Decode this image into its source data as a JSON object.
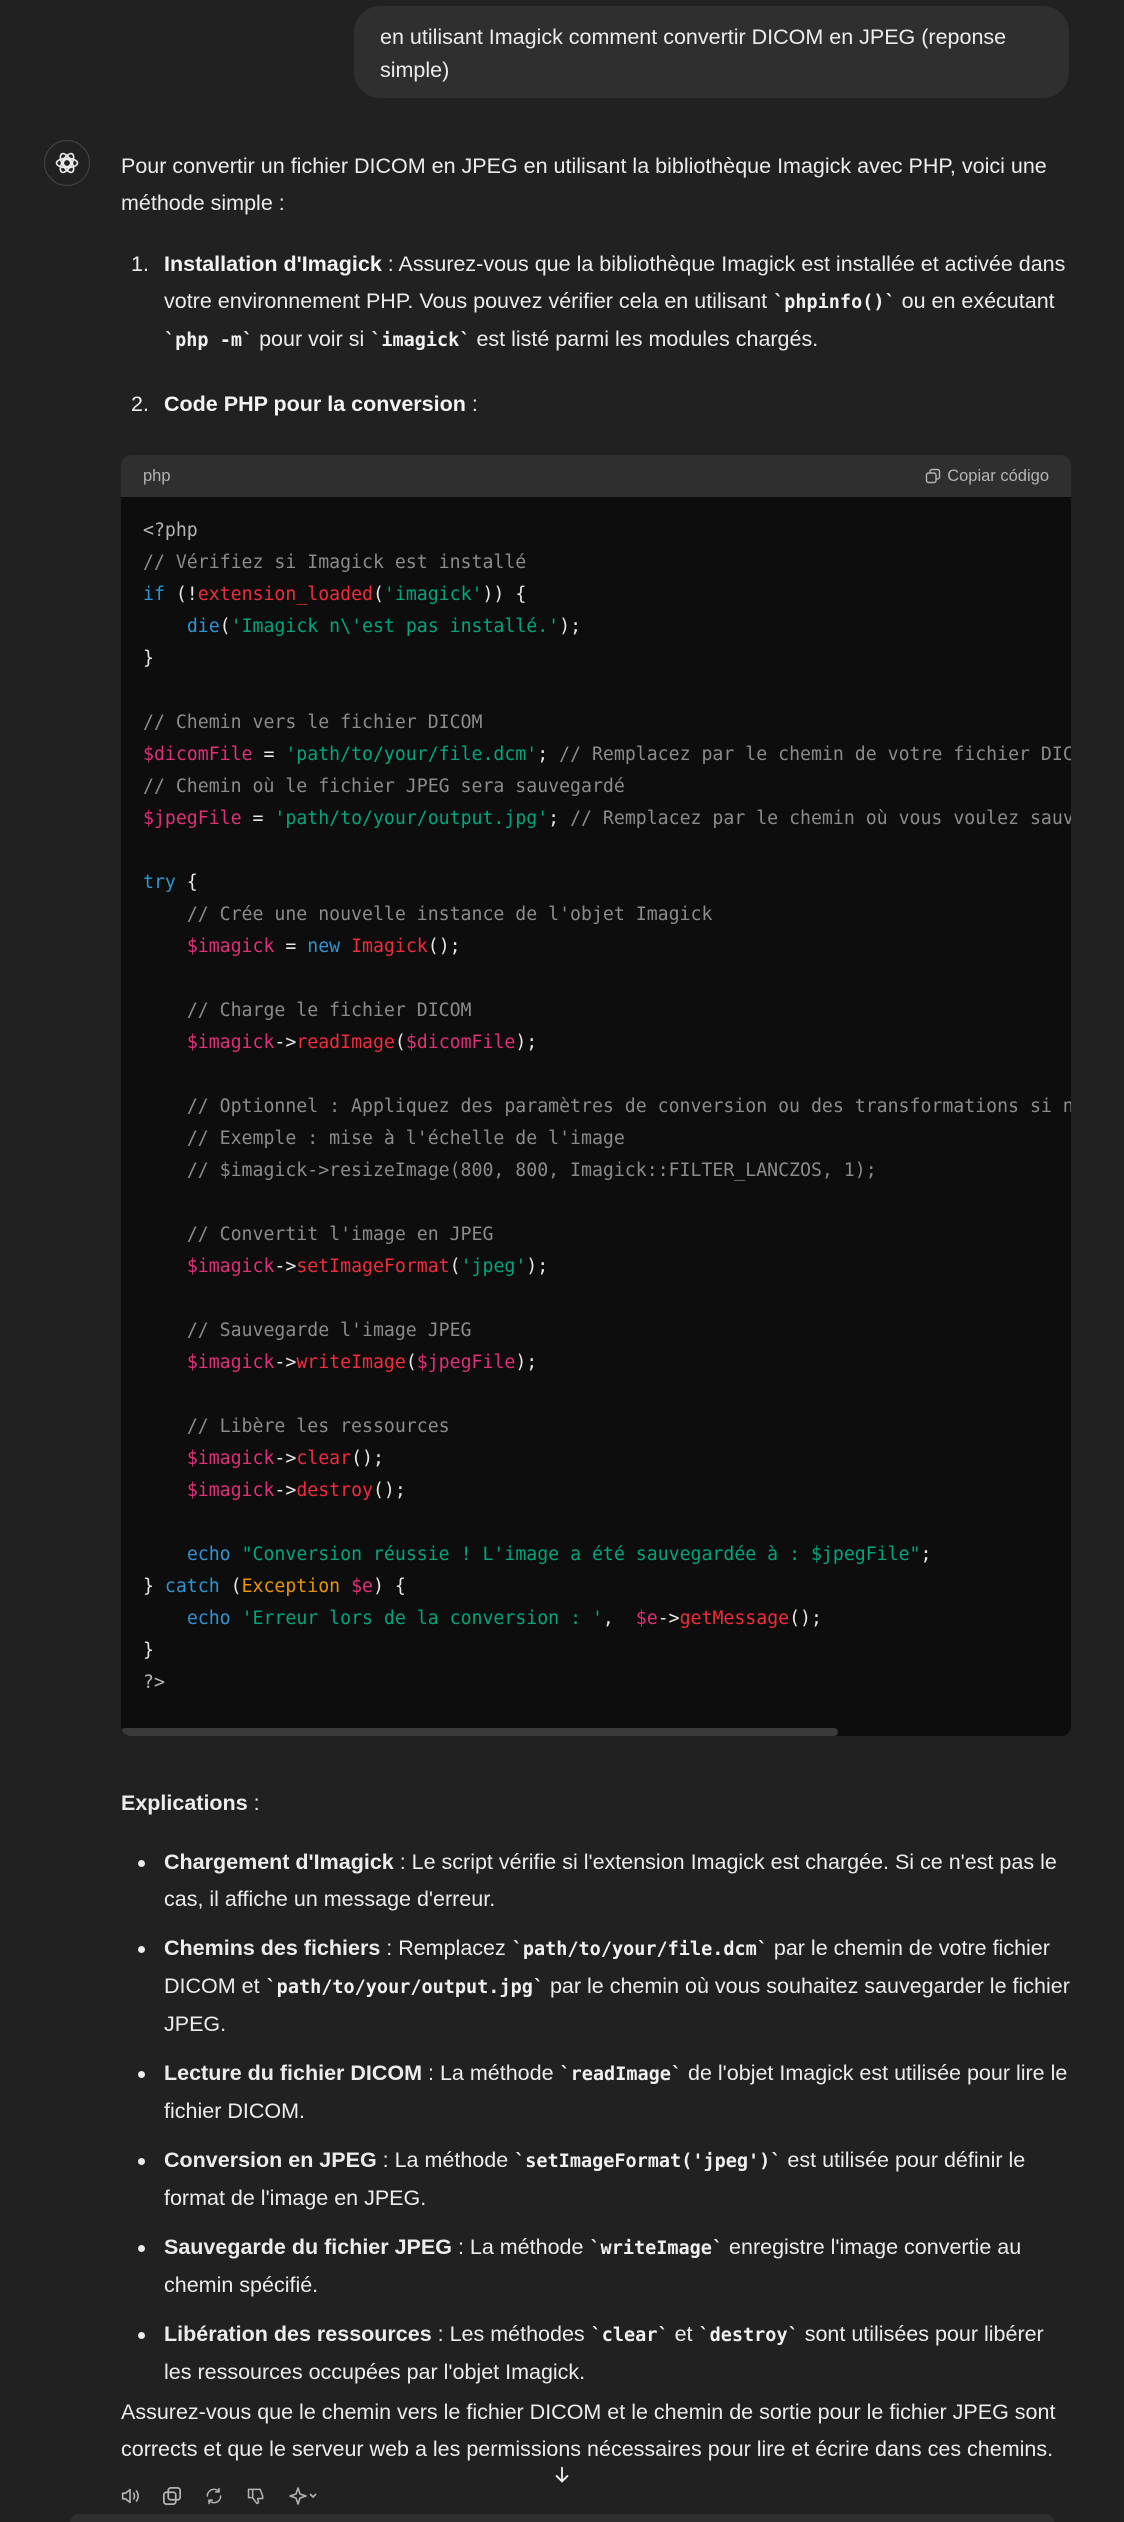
{
  "user_message": "en utilisant Imagick comment convertir DICOM en JPEG (reponse simple)",
  "answer": {
    "intro": "Pour convertir un fichier DICOM en JPEG en utilisant la bibliothèque Imagick avec PHP, voici une méthode simple :",
    "steps": [
      {
        "num": "1.",
        "title": "Installation d'Imagick",
        "t1": " : Assurez-vous que la bibliothèque Imagick est installée et activée dans votre environnement PHP. Vous pouvez vérifier cela en utilisant ",
        "c1": "`phpinfo()`",
        "t2": " ou en exécutant ",
        "c2": "`php -m`",
        "t3": " pour voir si ",
        "c3": "`imagick`",
        "t4": " est listé parmi les modules chargés."
      },
      {
        "num": "2.",
        "title": "Code PHP pour la conversion",
        "t1": " :"
      }
    ]
  },
  "code": {
    "language": "php",
    "copy_label": "Copiar código",
    "lines": [
      [
        {
          "t": "<?php",
          "c": "php"
        }
      ],
      [
        {
          "t": "// Vérifiez si Imagick est installé",
          "c": "com"
        }
      ],
      [
        {
          "t": "if",
          "c": "kw"
        },
        {
          "t": " (!",
          "c": "plain"
        },
        {
          "t": "extension_loaded",
          "c": "fn"
        },
        {
          "t": "(",
          "c": "plain"
        },
        {
          "t": "'imagick'",
          "c": "str"
        },
        {
          "t": ")) {",
          "c": "plain"
        }
      ],
      [
        {
          "t": "    ",
          "c": "plain"
        },
        {
          "t": "die",
          "c": "kw"
        },
        {
          "t": "(",
          "c": "plain"
        },
        {
          "t": "'Imagick n\\'est pas installé.'",
          "c": "str"
        },
        {
          "t": ");",
          "c": "plain"
        }
      ],
      [
        {
          "t": "}",
          "c": "plain"
        }
      ],
      [
        {
          "t": "",
          "c": "plain"
        }
      ],
      [
        {
          "t": "// Chemin vers le fichier DICOM",
          "c": "com"
        }
      ],
      [
        {
          "t": "$dicomFile",
          "c": "var"
        },
        {
          "t": " = ",
          "c": "plain"
        },
        {
          "t": "'path/to/your/file.dcm'",
          "c": "str"
        },
        {
          "t": "; ",
          "c": "plain"
        },
        {
          "t": "// Remplacez par le chemin de votre fichier DICOM",
          "c": "com"
        }
      ],
      [
        {
          "t": "// Chemin où le fichier JPEG sera sauvegardé",
          "c": "com"
        }
      ],
      [
        {
          "t": "$jpegFile",
          "c": "var"
        },
        {
          "t": " = ",
          "c": "plain"
        },
        {
          "t": "'path/to/your/output.jpg'",
          "c": "str"
        },
        {
          "t": "; ",
          "c": "plain"
        },
        {
          "t": "// Remplacez par le chemin où vous voulez sauvegarder",
          "c": "com"
        }
      ],
      [
        {
          "t": "",
          "c": "plain"
        }
      ],
      [
        {
          "t": "try",
          "c": "kw"
        },
        {
          "t": " {",
          "c": "plain"
        }
      ],
      [
        {
          "t": "    ",
          "c": "plain"
        },
        {
          "t": "// Crée une nouvelle instance de l'objet Imagick",
          "c": "com"
        }
      ],
      [
        {
          "t": "    ",
          "c": "plain"
        },
        {
          "t": "$imagick",
          "c": "var"
        },
        {
          "t": " = ",
          "c": "plain"
        },
        {
          "t": "new",
          "c": "kw"
        },
        {
          "t": " ",
          "c": "plain"
        },
        {
          "t": "Imagick",
          "c": "fn"
        },
        {
          "t": "();",
          "c": "plain"
        }
      ],
      [
        {
          "t": "",
          "c": "plain"
        }
      ],
      [
        {
          "t": "    ",
          "c": "plain"
        },
        {
          "t": "// Charge le fichier DICOM",
          "c": "com"
        }
      ],
      [
        {
          "t": "    ",
          "c": "plain"
        },
        {
          "t": "$imagick",
          "c": "var"
        },
        {
          "t": "->",
          "c": "plain"
        },
        {
          "t": "readImage",
          "c": "fn"
        },
        {
          "t": "(",
          "c": "plain"
        },
        {
          "t": "$dicomFile",
          "c": "var"
        },
        {
          "t": ");",
          "c": "plain"
        }
      ],
      [
        {
          "t": "",
          "c": "plain"
        }
      ],
      [
        {
          "t": "    ",
          "c": "plain"
        },
        {
          "t": "// Optionnel : Appliquez des paramètres de conversion ou des transformations si nécessaire",
          "c": "com"
        }
      ],
      [
        {
          "t": "    ",
          "c": "plain"
        },
        {
          "t": "// Exemple : mise à l'échelle de l'image",
          "c": "com"
        }
      ],
      [
        {
          "t": "    ",
          "c": "plain"
        },
        {
          "t": "// $imagick->resizeImage(800, 800, Imagick::FILTER_LANCZOS, 1);",
          "c": "com"
        }
      ],
      [
        {
          "t": "",
          "c": "plain"
        }
      ],
      [
        {
          "t": "    ",
          "c": "plain"
        },
        {
          "t": "// Convertit l'image en JPEG",
          "c": "com"
        }
      ],
      [
        {
          "t": "    ",
          "c": "plain"
        },
        {
          "t": "$imagick",
          "c": "var"
        },
        {
          "t": "->",
          "c": "plain"
        },
        {
          "t": "setImageFormat",
          "c": "fn"
        },
        {
          "t": "(",
          "c": "plain"
        },
        {
          "t": "'jpeg'",
          "c": "str"
        },
        {
          "t": ");",
          "c": "plain"
        }
      ],
      [
        {
          "t": "",
          "c": "plain"
        }
      ],
      [
        {
          "t": "    ",
          "c": "plain"
        },
        {
          "t": "// Sauvegarde l'image JPEG",
          "c": "com"
        }
      ],
      [
        {
          "t": "    ",
          "c": "plain"
        },
        {
          "t": "$imagick",
          "c": "var"
        },
        {
          "t": "->",
          "c": "plain"
        },
        {
          "t": "writeImage",
          "c": "fn"
        },
        {
          "t": "(",
          "c": "plain"
        },
        {
          "t": "$jpegFile",
          "c": "var"
        },
        {
          "t": ");",
          "c": "plain"
        }
      ],
      [
        {
          "t": "",
          "c": "plain"
        }
      ],
      [
        {
          "t": "    ",
          "c": "plain"
        },
        {
          "t": "// Libère les ressources",
          "c": "com"
        }
      ],
      [
        {
          "t": "    ",
          "c": "plain"
        },
        {
          "t": "$imagick",
          "c": "var"
        },
        {
          "t": "->",
          "c": "plain"
        },
        {
          "t": "clear",
          "c": "fn"
        },
        {
          "t": "();",
          "c": "plain"
        }
      ],
      [
        {
          "t": "    ",
          "c": "plain"
        },
        {
          "t": "$imagick",
          "c": "var"
        },
        {
          "t": "->",
          "c": "plain"
        },
        {
          "t": "destroy",
          "c": "fn"
        },
        {
          "t": "();",
          "c": "plain"
        }
      ],
      [
        {
          "t": "",
          "c": "plain"
        }
      ],
      [
        {
          "t": "    ",
          "c": "plain"
        },
        {
          "t": "echo",
          "c": "kw"
        },
        {
          "t": " ",
          "c": "plain"
        },
        {
          "t": "\"Conversion réussie ! L'image a été sauvegardée à : $jpegFile\"",
          "c": "str"
        },
        {
          "t": ";",
          "c": "plain"
        }
      ],
      [
        {
          "t": "} ",
          "c": "plain"
        },
        {
          "t": "catch",
          "c": "kw"
        },
        {
          "t": " (",
          "c": "plain"
        },
        {
          "t": "Exception",
          "c": "cls"
        },
        {
          "t": " ",
          "c": "plain"
        },
        {
          "t": "$e",
          "c": "var"
        },
        {
          "t": ") {",
          "c": "plain"
        }
      ],
      [
        {
          "t": "    ",
          "c": "plain"
        },
        {
          "t": "echo",
          "c": "kw"
        },
        {
          "t": " ",
          "c": "plain"
        },
        {
          "t": "'Erreur lors de la conversion : '",
          "c": "str"
        },
        {
          "t": ",  ",
          "c": "plain"
        },
        {
          "t": "$e",
          "c": "var"
        },
        {
          "t": "->",
          "c": "plain"
        },
        {
          "t": "getMessage",
          "c": "fn"
        },
        {
          "t": "();",
          "c": "plain"
        }
      ],
      [
        {
          "t": "}",
          "c": "plain"
        }
      ],
      [
        {
          "t": "?>",
          "c": "php"
        }
      ]
    ]
  },
  "explanations": {
    "heading": "Explications",
    "heading_suffix": " :",
    "items": [
      {
        "title": "Chargement d'Imagick",
        "parts": [
          {
            "t": " : Le script vérifie si l'extension Imagick est chargée. Si ce n'est pas le cas, il affiche un message d'erreur."
          }
        ]
      },
      {
        "title": "Chemins des fichiers",
        "parts": [
          {
            "t": " : Remplacez "
          },
          {
            "c": "`path/to/your/file.dcm`"
          },
          {
            "t": " par le chemin de votre fichier DICOM et "
          },
          {
            "c": "`path/to/your/output.jpg`"
          },
          {
            "t": " par le chemin où vous souhaitez sauvegarder le fichier JPEG."
          }
        ]
      },
      {
        "title": "Lecture du fichier DICOM",
        "parts": [
          {
            "t": " : La méthode "
          },
          {
            "c": "`readImage`"
          },
          {
            "t": " de l'objet Imagick est utilisée pour lire le fichier DICOM."
          }
        ]
      },
      {
        "title": "Conversion en JPEG",
        "parts": [
          {
            "t": " : La méthode "
          },
          {
            "c": "`setImageFormat('jpeg')`"
          },
          {
            "t": " est utilisée pour définir le format de l'image en JPEG."
          }
        ]
      },
      {
        "title": "Sauvegarde du fichier JPEG",
        "parts": [
          {
            "t": " : La méthode "
          },
          {
            "c": "`writeImage`"
          },
          {
            "t": " enregistre l'image convertie au chemin spécifié."
          }
        ]
      },
      {
        "title": "Libération des ressources",
        "parts": [
          {
            "t": " : Les méthodes "
          },
          {
            "c": "`clear`"
          },
          {
            "t": " et "
          },
          {
            "c": "`destroy`"
          },
          {
            "t": " sont utilisées pour libérer les ressources occupées par l'objet Imagick."
          }
        ]
      }
    ]
  },
  "closing": "Assurez-vous que le chemin vers le fichier DICOM et le chemin de sortie pour le fichier JPEG sont corrects et que le serveur web a les permissions nécessaires pour lire et écrire dans ces chemins.",
  "colors": {
    "background": "#212121",
    "user_bubble": "#2f2f2f",
    "code_bg": "#0d0d0d",
    "code_header": "#2f2f2f",
    "comment": "#8b8b8b",
    "keyword": "#2e95d3",
    "string": "#00a67d",
    "variable": "#df3079",
    "function": "#f22c3d",
    "class": "#e9950c"
  },
  "icons": {
    "avatar": "assistant-logo-icon",
    "copy": "copy-icon",
    "actions": [
      "read-aloud-icon",
      "copy-icon",
      "regenerate-icon",
      "thumbs-down-icon",
      "sparkle-model-icon"
    ],
    "scroll": "arrow-down-icon"
  }
}
